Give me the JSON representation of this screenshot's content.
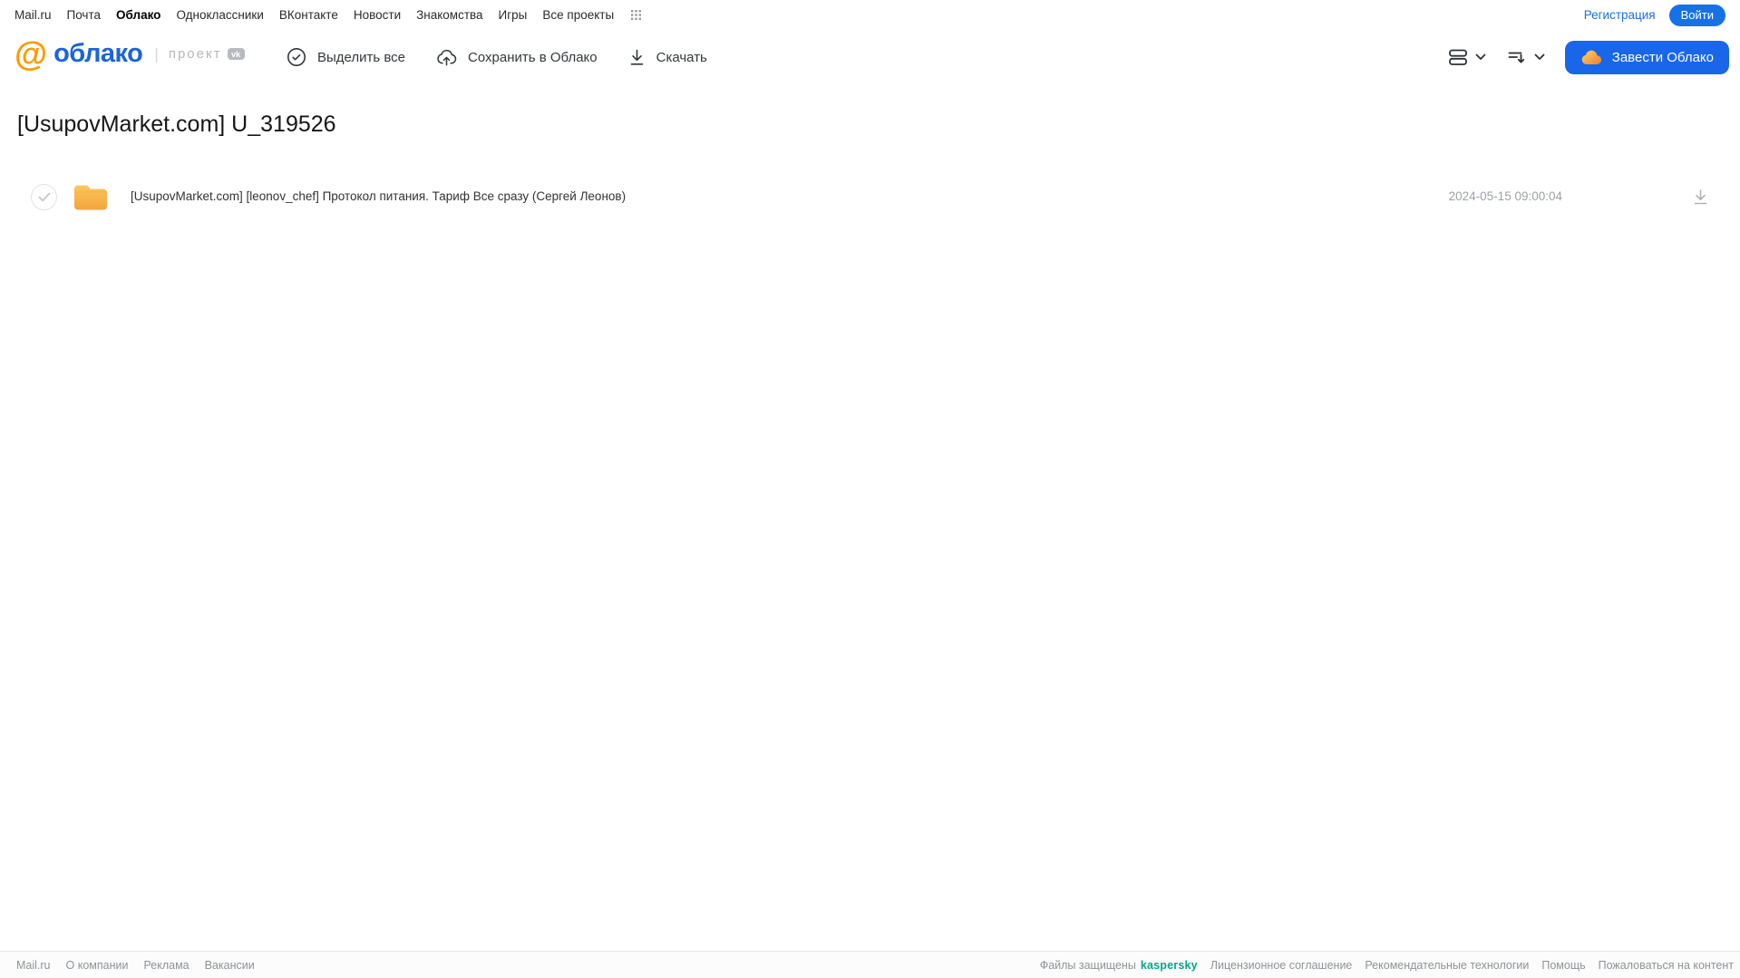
{
  "topnav": {
    "items": [
      "Mail.ru",
      "Почта",
      "Облако",
      "Одноклассники",
      "ВКонтакте",
      "Новости",
      "Знакомства",
      "Игры",
      "Все проекты"
    ],
    "registration_label": "Регистрация",
    "login_label": "Войти"
  },
  "header": {
    "logo": {
      "at": "@",
      "text": "облако",
      "project": "проект",
      "vk": "vk"
    },
    "toolbar": {
      "select_all": "Выделить все",
      "save_to_cloud": "Сохранить в Облако",
      "download": "Скачать"
    },
    "get_cloud_label": "Завести Облако"
  },
  "main": {
    "page_title": "[UsupovMarket.com] U_319526",
    "files": [
      {
        "name": "[UsupovMarket.com] [leonov_chef]  Протокол питания. Тариф Все сразу (Сергей Леонов)",
        "date": "2024-05-15 09:00:04"
      }
    ]
  },
  "footer": {
    "links_left": [
      "Mail.ru",
      "О компании",
      "Реклама",
      "Вакансии"
    ],
    "protected_by": "Файлы защищены",
    "kaspersky_label": "kaspersky",
    "links_right": [
      "Лицензионное соглашение",
      "Рекомендательные технологии",
      "Помощь",
      "Пожаловаться на контент"
    ]
  },
  "colors": {
    "accent_blue": "#1771e6",
    "logo_blue": "#1b64da",
    "logo_orange": "#ff9900",
    "folder_orange": "#f5a93f",
    "kaspersky_teal": "#00a88e"
  }
}
